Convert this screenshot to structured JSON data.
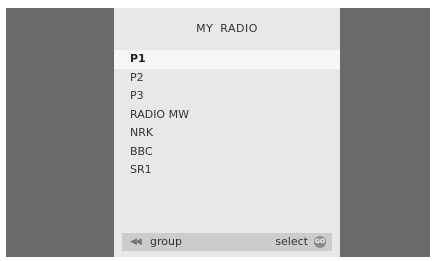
{
  "menu": {
    "title": "MY  RADIO",
    "items": [
      {
        "label": "P1",
        "selected": true
      },
      {
        "label": "P2"
      },
      {
        "label": "P3"
      },
      {
        "label": "RADIO MW"
      },
      {
        "label": "NRK"
      },
      {
        "label": "BBC"
      },
      {
        "label": "SR1"
      }
    ]
  },
  "footer": {
    "rewind_icon": "◀◀",
    "group_label": "group",
    "select_label": "select",
    "go_icon": "GO"
  },
  "colors": {
    "backdrop": "#6a6a6a",
    "panel": "#e8e8e8",
    "selected_row": "#f6f6f6",
    "footer_bar": "#cccccc"
  }
}
